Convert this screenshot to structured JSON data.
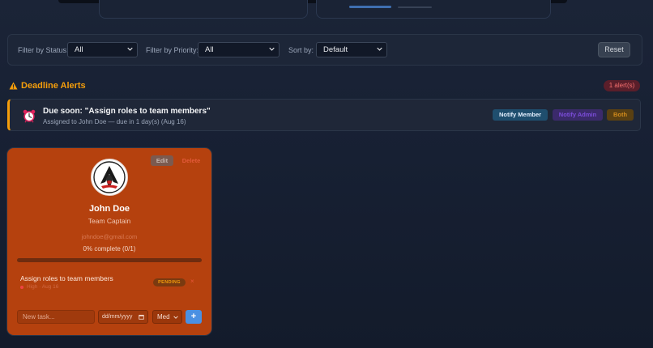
{
  "filters": {
    "status_label": "Filter by Status:",
    "status_value": "All",
    "priority_label": "Filter by Priority:",
    "priority_value": "All",
    "sort_label": "Sort by:",
    "sort_value": "Default",
    "reset_label": "Reset"
  },
  "alerts": {
    "title": "Deadline Alerts",
    "count": "1 alert(s)",
    "items": [
      {
        "title": "Due soon: \"Assign roles to team members\"",
        "subtitle": "Assigned to John Doe — due in 1 day(s) (Aug 16)",
        "notify_member": "Notify Member",
        "notify_admin": "Notify Admin",
        "both": "Both"
      }
    ]
  },
  "member": {
    "edit_label": "Edit",
    "delete_label": "Delete",
    "name": "John Doe",
    "role": "Team Captain",
    "email": "johndoe@gmail.com",
    "progress_text": "0% complete (0/1)",
    "progress": 0,
    "task": {
      "title": "Assign roles to team members",
      "meta": "High · Aug 16",
      "status": "PENDING",
      "remove": "×"
    },
    "new_task_placeholder": "New task...",
    "date_placeholder": "dd/mm/yyyy",
    "priority_value": "Med",
    "add_label": "+"
  },
  "colors": {
    "accent": "#f59e0b",
    "card": "#b5410e",
    "add_button": "#4a90e2"
  }
}
